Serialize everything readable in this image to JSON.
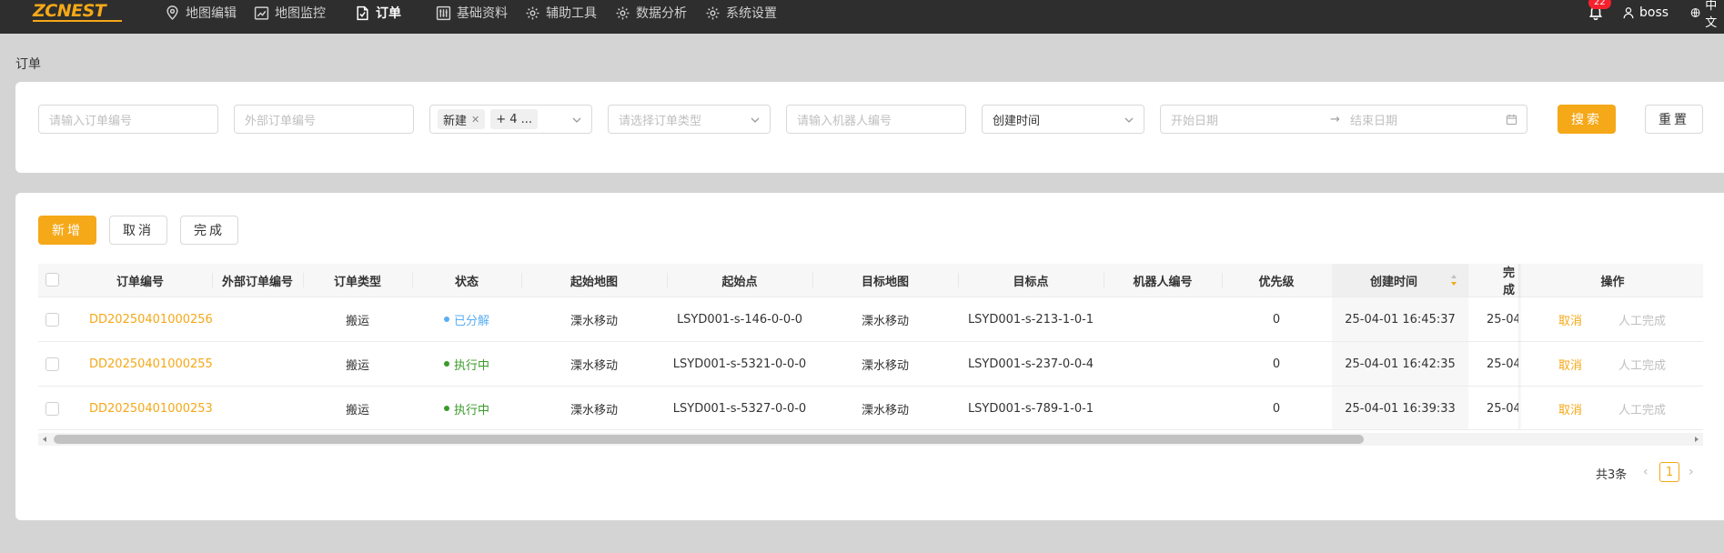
{
  "brand": {
    "logo": "ZCNEST"
  },
  "nav": [
    {
      "label": "地图编辑",
      "icon": "map-pin-icon"
    },
    {
      "label": "地图监控",
      "icon": "chart-line-icon"
    },
    {
      "label": "订单",
      "icon": "document-icon"
    },
    {
      "label": "基础资料",
      "icon": "sliders-icon"
    },
    {
      "label": "辅助工具",
      "icon": "gear-icon"
    },
    {
      "label": "数据分析",
      "icon": "gear-icon"
    },
    {
      "label": "系统设置",
      "icon": "gear-icon"
    }
  ],
  "header": {
    "notifications": "22",
    "username": "boss",
    "language": "中文"
  },
  "page": {
    "title": "订单"
  },
  "filters": {
    "order_no_placeholder": "请输入订单编号",
    "external_no_placeholder": "外部订单编号",
    "status_tag": "新建",
    "status_more": "+ 4 ...",
    "order_type_placeholder": "请选择订单类型",
    "robot_placeholder": "请输入机器人编号",
    "time_type": "创建时间",
    "start_date_placeholder": "开始日期",
    "date_arrow": "→",
    "end_date_placeholder": "结束日期",
    "search_label": "搜索",
    "reset_label": "重置"
  },
  "toolbar": {
    "add_label": "新增",
    "cancel_label": "取消",
    "complete_label": "完成"
  },
  "table": {
    "columns": [
      "订单编号",
      "外部订单编号",
      "订单类型",
      "状态",
      "起始地图",
      "起始点",
      "目标地图",
      "目标点",
      "机器人编号",
      "优先级",
      "创建时间",
      "完成",
      "操作"
    ],
    "rows": [
      {
        "order_no": "DD20250401000256",
        "external_no": "",
        "type": "搬运",
        "status": "已分解",
        "start_map": "溧水移动",
        "start_point": "LSYD001-s-146-0-0-0",
        "target_map": "溧水移动",
        "target_point": "LSYD001-s-213-1-0-1",
        "robot": "",
        "priority": "0",
        "created": "25-04-01 16:45:37",
        "finished": "25-04-",
        "action_cancel": "取消",
        "action_manual": "人工完成"
      },
      {
        "order_no": "DD20250401000255",
        "external_no": "",
        "type": "搬运",
        "status": "执行中",
        "start_map": "溧水移动",
        "start_point": "LSYD001-s-5321-0-0-0",
        "target_map": "溧水移动",
        "target_point": "LSYD001-s-237-0-0-4",
        "robot": "",
        "priority": "0",
        "created": "25-04-01 16:42:35",
        "finished": "25-04-",
        "action_cancel": "取消",
        "action_manual": "人工完成"
      },
      {
        "order_no": "DD20250401000253",
        "external_no": "",
        "type": "搬运",
        "status": "执行中",
        "start_map": "溧水移动",
        "start_point": "LSYD001-s-5327-0-0-0",
        "target_map": "溧水移动",
        "target_point": "LSYD001-s-789-1-0-1",
        "robot": "",
        "priority": "0",
        "created": "25-04-01 16:39:33",
        "finished": "25-04-",
        "action_cancel": "取消",
        "action_manual": "人工完成"
      }
    ]
  },
  "pagination": {
    "total": "共3条",
    "current": "1",
    "prev": "‹",
    "next": "›"
  },
  "colors": {
    "accent": "#f5a818",
    "status_decomposed": "#5aaef2",
    "status_running": "#3a9a2a",
    "topbar": "#2e2e2e"
  }
}
